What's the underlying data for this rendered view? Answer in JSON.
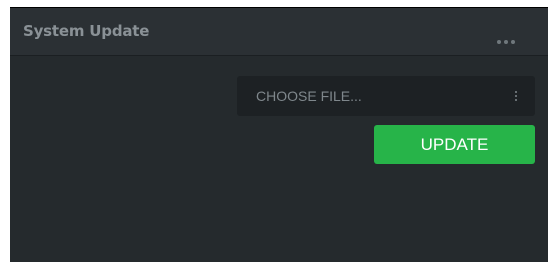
{
  "panel": {
    "title": "System Update",
    "more_icon": "more-horizontal-icon"
  },
  "file_picker": {
    "placeholder": "CHOOSE FILE...",
    "menu_icon": "more-vertical-icon"
  },
  "update_button": {
    "label": "UPDATE",
    "color": "#27b449"
  }
}
